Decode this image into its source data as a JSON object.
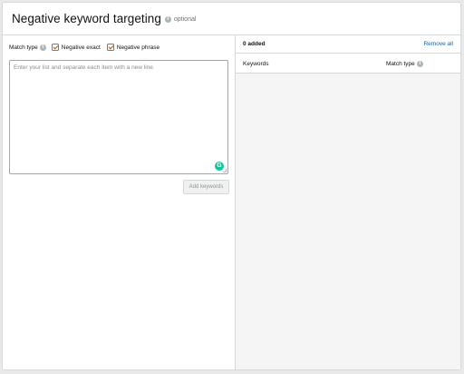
{
  "header": {
    "title": "Negative keyword targeting",
    "optional_label": "optional",
    "info_icon": "info-icon"
  },
  "left": {
    "match_type_label": "Match type",
    "options": [
      {
        "label": "Negative exact",
        "checked": true
      },
      {
        "label": "Negative phrase",
        "checked": true
      }
    ],
    "textarea": {
      "placeholder": "Enter your list and separate each item with a new line.",
      "value": ""
    },
    "add_button_label": "Add keywords"
  },
  "right": {
    "added_count_label": "0 added",
    "remove_all_label": "Remove all",
    "columns": {
      "keywords": "Keywords",
      "match_type": "Match type"
    }
  },
  "colors": {
    "checkbox_check": "#c45500",
    "link": "#0066c0",
    "grammarly": "#15c39a"
  }
}
